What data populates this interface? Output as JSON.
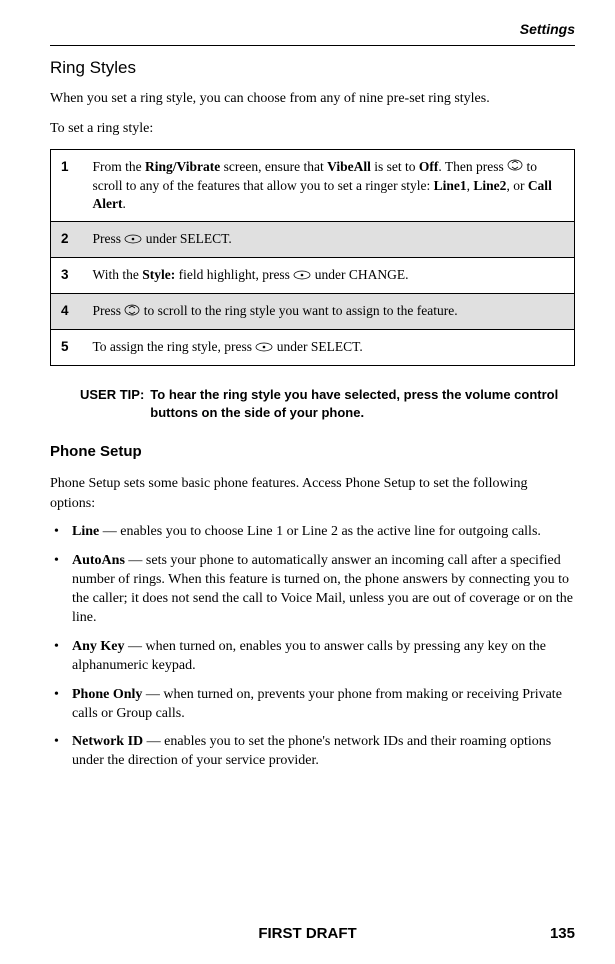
{
  "header": {
    "section": "Settings"
  },
  "ring_styles": {
    "title": "Ring Styles",
    "intro": "When you set a ring style, you can choose from any of nine pre-set ring styles.",
    "subtitle": "To set a ring style:",
    "steps": [
      {
        "num": "1",
        "text_before": "From the ",
        "b1": "Ring/Vibrate",
        "text_mid1": " screen, ensure that ",
        "b2": "VibeAll",
        "text_mid2": " is set to ",
        "b3": "Off",
        "text_mid3": ". Then press ",
        "text_mid4": " to scroll to any of the features that allow you to set a ringer style: ",
        "b4": "Line1",
        "sep1": ", ",
        "b5": "Line2",
        "sep2": ", or ",
        "b6": "Call Alert",
        "text_end": "."
      },
      {
        "num": "2",
        "text_before": "Press ",
        "text_after": " under SELECT."
      },
      {
        "num": "3",
        "text_before": "With the ",
        "b1": "Style:",
        "text_mid": " field highlight, press ",
        "text_after": " under CHANGE."
      },
      {
        "num": "4",
        "text_before": "Press ",
        "text_after": " to scroll to the ring style you want to assign to the feature."
      },
      {
        "num": "5",
        "text_before": "To assign the ring style, press ",
        "text_after": " under SELECT."
      }
    ],
    "user_tip_label": "USER TIP:",
    "user_tip_text": "To hear the ring style you have selected, press the volume control buttons on the side of your phone."
  },
  "phone_setup": {
    "title": "Phone Setup",
    "intro": "Phone Setup sets some basic phone features. Access Phone Setup to set the following options:",
    "items": [
      {
        "term": "Line",
        "desc": " — enables you to choose Line 1 or Line 2 as the active line for outgoing calls."
      },
      {
        "term": "AutoAns",
        "desc": " — sets your phone to automatically answer an incoming call after a specified number of rings. When this feature is turned on, the phone answers by connecting you to the caller; it does not send the call to Voice Mail, unless you are out of coverage or on the line."
      },
      {
        "term": "Any Key",
        "desc": " — when turned on, enables you to answer calls by pressing any key on the alphanumeric keypad."
      },
      {
        "term": "Phone Only",
        "desc": " — when turned on, prevents your phone from making or receiving Private calls or Group calls."
      },
      {
        "term": "Network ID",
        "desc": " — enables you to set the phone's network IDs and their roaming options under the direction of your service provider."
      }
    ]
  },
  "footer": {
    "draft": "FIRST DRAFT",
    "page": "135"
  }
}
